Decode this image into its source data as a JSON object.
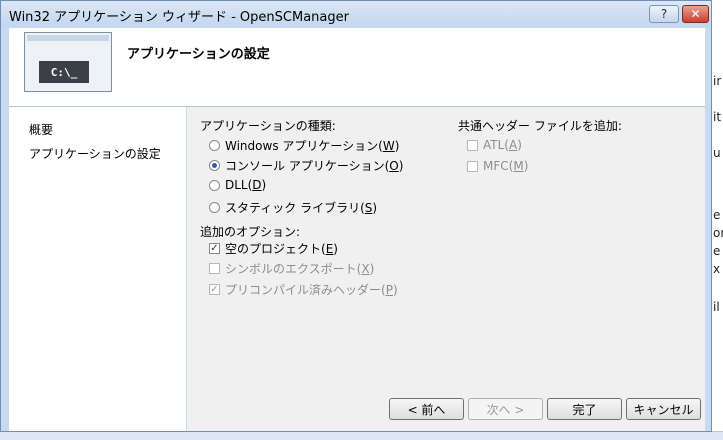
{
  "window": {
    "title": "Win32 アプリケーション ウィザード - OpenSCManager"
  },
  "title_buttons": {
    "help": "?",
    "close": "✕"
  },
  "header": {
    "title": "アプリケーションの設定",
    "icon_text": "C:\\_"
  },
  "nav": {
    "items": [
      "概要",
      "アプリケーションの設定"
    ]
  },
  "app_type": {
    "label": "アプリケーションの種類:",
    "options": [
      {
        "text": "Windows アプリケーション(",
        "key": "W",
        "selected": false
      },
      {
        "text": "コンソール アプリケーション(",
        "key": "O",
        "selected": true
      },
      {
        "text": "DLL(",
        "key": "D",
        "selected": false
      },
      {
        "text": "スタティック ライブラリ(",
        "key": "S",
        "selected": false
      }
    ]
  },
  "extra_options": {
    "label": "追加のオプション:",
    "items": [
      {
        "text": "空のプロジェクト(",
        "key": "E",
        "checked": true,
        "enabled": true
      },
      {
        "text": "シンボルのエクスポート(",
        "key": "X",
        "checked": false,
        "enabled": false
      },
      {
        "text": "プリコンパイル済みヘッダー(",
        "key": "P",
        "checked": true,
        "enabled": false
      }
    ]
  },
  "common_headers": {
    "label": "共通ヘッダー ファイルを追加:",
    "items": [
      {
        "text": "ATL(",
        "key": "A",
        "checked": false,
        "enabled": false
      },
      {
        "text": "MFC(",
        "key": "M",
        "checked": false,
        "enabled": false
      }
    ]
  },
  "buttons": {
    "prev": "< 前へ",
    "next": "次へ >",
    "finish": "完了",
    "cancel": "キャンセル"
  },
  "background": {
    "fragments": [
      "ir",
      "it",
      "u",
      "e",
      "or",
      "e",
      "x",
      "il"
    ]
  }
}
